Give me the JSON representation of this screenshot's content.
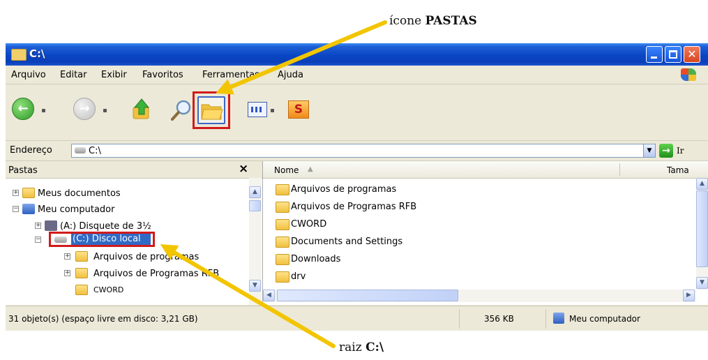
{
  "annotations": {
    "top_prefix": "ícone",
    "top_bold": "PASTAS",
    "bottom_prefix": "raiz",
    "bottom_bold": "C:\\"
  },
  "window": {
    "title": "C:\\"
  },
  "menu": {
    "items": [
      "Arquivo",
      "Editar",
      "Exibir",
      "Favoritos",
      "Ferramentas",
      "Ajuda"
    ]
  },
  "toolbar": {
    "snagit_letter": "S"
  },
  "address": {
    "label": "Endereço",
    "value": "C:\\",
    "go_label": "Ir"
  },
  "folders_pane": {
    "title": "Pastas",
    "close": "×",
    "items": [
      {
        "label": "Meus documentos"
      },
      {
        "label": "Meu computador"
      },
      {
        "label": "(A:) Disquete de 3½"
      },
      {
        "label": "(C:) Disco local"
      },
      {
        "label": "Arquivos de programas"
      },
      {
        "label": "Arquivos de Programas RFB"
      },
      {
        "label": "CWORD"
      }
    ]
  },
  "contents": {
    "col_name": "Nome",
    "col_size": "Tama",
    "items": [
      "Arquivos de programas",
      "Arquivos de Programas RFB",
      "CWORD",
      "Documents and Settings",
      "Downloads",
      "drv"
    ]
  },
  "status": {
    "objects": "31 objeto(s) (espaço livre em disco: 3,21 GB)",
    "size": "356 KB",
    "location": "Meu computador"
  },
  "colors": {
    "highlight_red": "#d11a1a",
    "arrow_yellow": "#f2c500",
    "selection_blue": "#316ac5"
  }
}
